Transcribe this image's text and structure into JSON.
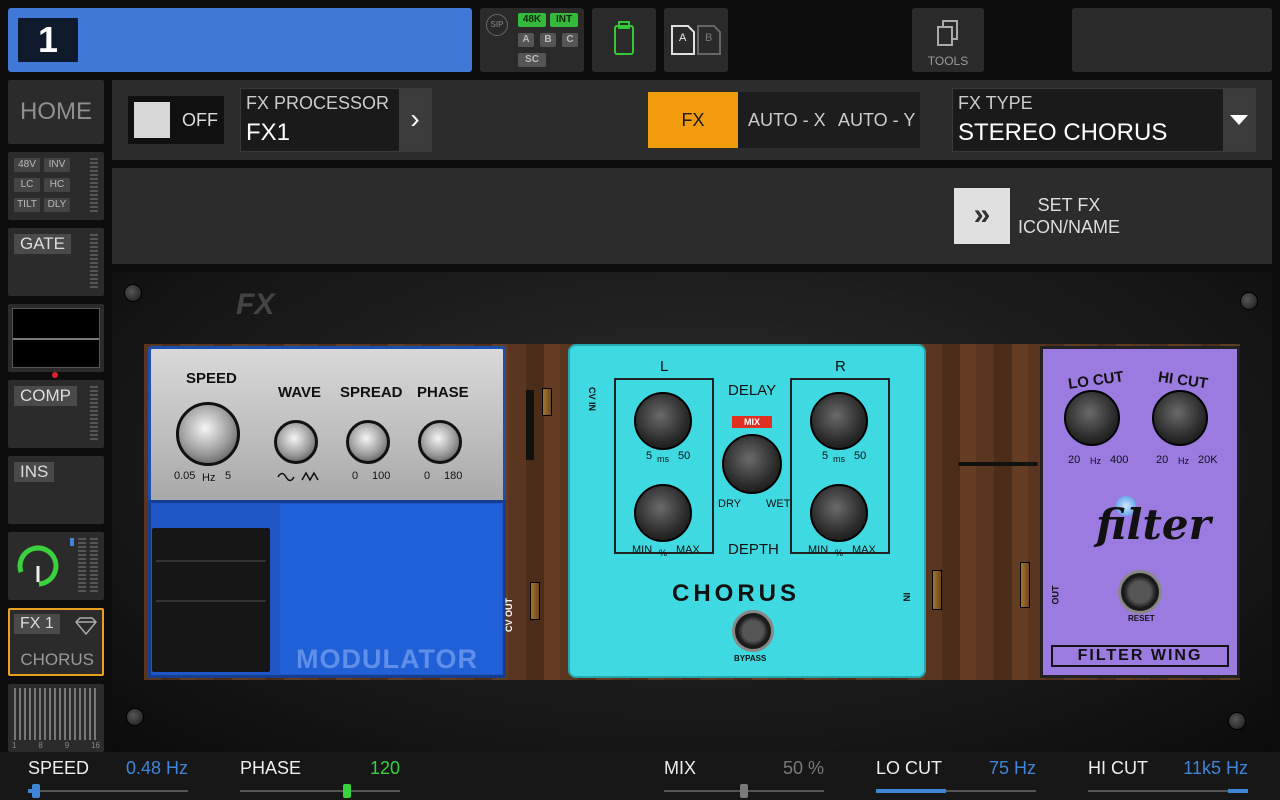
{
  "top": {
    "channel_number": "1",
    "sip": "SIP",
    "rate_tag": "48K",
    "clock_tag": "INT",
    "bus_tags": [
      "A",
      "B",
      "C"
    ],
    "sc_tag": "SC",
    "ab_tags": [
      "A",
      "B"
    ],
    "tools_label": "TOOLS"
  },
  "sidebar": {
    "home": "HOME",
    "preamp_tags": [
      "48V",
      "INV",
      "LC",
      "HC",
      "TILT",
      "DLY"
    ],
    "gate": "GATE",
    "comp": "COMP",
    "ins": "INS",
    "fx1": "FX 1",
    "fx1_type": "CHORUS",
    "bus_scale": [
      "1",
      "8",
      "9",
      "16"
    ]
  },
  "header": {
    "toggle_label": "OFF",
    "processor_caption": "FX PROCESSOR",
    "processor_value": "FX1",
    "mode_buttons": [
      "FX",
      "AUTO - X",
      "AUTO - Y"
    ],
    "fx_type_caption": "FX TYPE",
    "fx_type_value": "STEREO CHORUS",
    "set_fx_line1": "SET FX",
    "set_fx_line2": "ICON/NAME"
  },
  "pedals": {
    "fx_logo": "FX",
    "modulator": {
      "name": "MODULATOR",
      "speed": "SPEED",
      "wave": "WAVE",
      "spread": "SPREAD",
      "phase": "PHASE",
      "speed_min": "0.05",
      "speed_unit": "Hz",
      "speed_max": "5",
      "spread_min": "0",
      "spread_max": "100",
      "phase_min": "0",
      "phase_max": "180",
      "cv_out": "CV OUT"
    },
    "chorus": {
      "name": "CHORUS",
      "left": "L",
      "right": "R",
      "delay": "DELAY",
      "depth": "DEPTH",
      "mix": "MIX",
      "dry": "DRY",
      "wet": "WET",
      "delay_min": "5",
      "delay_unit": "ms",
      "delay_max": "50",
      "depth_min": "MIN",
      "depth_unit": "%",
      "depth_max": "MAX",
      "bypass": "BYPASS",
      "cv_in": "CV IN",
      "in": "IN"
    },
    "filter": {
      "name": "FILTER WING",
      "script": "filter",
      "lo_cut": "LO CUT",
      "hi_cut": "HI CUT",
      "lo_min": "20",
      "lo_unit": "Hz",
      "lo_max": "400",
      "hi_min": "20",
      "hi_unit": "Hz",
      "hi_max": "20K",
      "reset": "RESET",
      "out": "OUT"
    }
  },
  "params": [
    {
      "name": "SPEED",
      "value": "0.48 Hz",
      "color": "#3f86d9",
      "level": 0.05
    },
    {
      "name": "PHASE",
      "value": "120",
      "color": "#3ad13f",
      "level": 0.67
    },
    {
      "name": "MIX",
      "value": "50 %",
      "color": "#7a7a7a",
      "level": 0.5
    },
    {
      "name": "LO CUT",
      "value": "75 Hz",
      "color": "#3f86d9",
      "level": 0.45
    },
    {
      "name": "HI CUT",
      "value": "11k5 Hz",
      "color": "#3f86d9",
      "level": 0.97
    }
  ],
  "colors": {
    "accent_blue": "#3f78d6",
    "fx_orange": "#f29b0d",
    "status_green": "#35b93a",
    "selected_border": "#e8a020"
  }
}
